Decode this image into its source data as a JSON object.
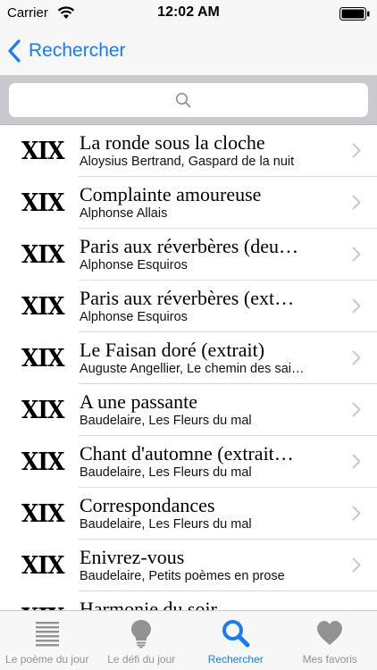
{
  "status_bar": {
    "carrier": "Carrier",
    "time": "12:02 AM"
  },
  "nav": {
    "back_label": "Rechercher"
  },
  "search": {
    "placeholder": ""
  },
  "list": {
    "items": [
      {
        "century": "XIX",
        "title": "La ronde sous la cloche",
        "subtitle": "Aloysius Bertrand, Gaspard de la nuit"
      },
      {
        "century": "XIX",
        "title": "Complainte amoureuse",
        "subtitle": "Alphonse Allais"
      },
      {
        "century": "XIX",
        "title": "Paris aux réverbères (deu…",
        "subtitle": "Alphonse Esquiros"
      },
      {
        "century": "XIX",
        "title": "Paris aux réverbères (ext…",
        "subtitle": "Alphonse Esquiros"
      },
      {
        "century": "XIX",
        "title": "Le Faisan doré (extrait)",
        "subtitle": "Auguste Angellier, Le chemin des sai…"
      },
      {
        "century": "XIX",
        "title": "A une passante",
        "subtitle": "Baudelaire, Les Fleurs du mal"
      },
      {
        "century": "XIX",
        "title": "Chant d'automne (extrait…",
        "subtitle": "Baudelaire, Les Fleurs du mal"
      },
      {
        "century": "XIX",
        "title": "Correspondances",
        "subtitle": "Baudelaire, Les Fleurs du mal"
      },
      {
        "century": "XIX",
        "title": "Enivrez-vous",
        "subtitle": "Baudelaire, Petits poèmes en prose"
      },
      {
        "century": "XIX",
        "title": "Harmonie du soir",
        "subtitle": ""
      }
    ]
  },
  "tabs": [
    {
      "label": "Le poème du jour",
      "icon": "list-lines-icon",
      "active": false
    },
    {
      "label": "Le défi du jour",
      "icon": "lightbulb-icon",
      "active": false
    },
    {
      "label": "Rechercher",
      "icon": "magnifier-icon",
      "active": true
    },
    {
      "label": "Mes favoris",
      "icon": "heart-icon",
      "active": false
    }
  ],
  "colors": {
    "accent": "#1a7cf5",
    "inactive_tab": "#929292",
    "search_bg": "#c9c9ce"
  }
}
